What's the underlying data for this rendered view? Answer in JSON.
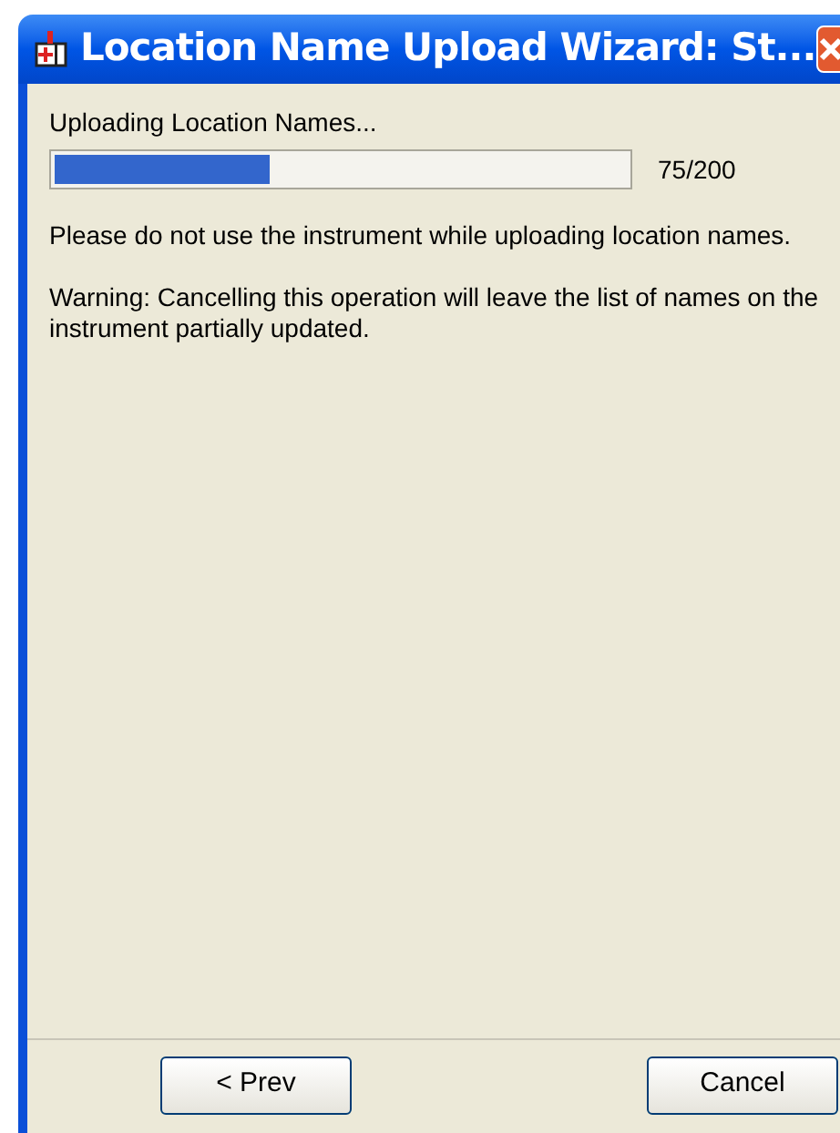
{
  "window": {
    "title": "Location Name Upload Wizard: St..."
  },
  "status": {
    "label": "Uploading Location Names...",
    "level": 0.375,
    "count": "75/200"
  },
  "messages": [
    "Please do not use the instrument while uploading location names.",
    "Warning: Cancelling this operation will leave the list of names on the instrument partially updated."
  ],
  "buttons": [
    {
      "label": "< Prev"
    },
    {
      "label": "Cancel"
    }
  ]
}
